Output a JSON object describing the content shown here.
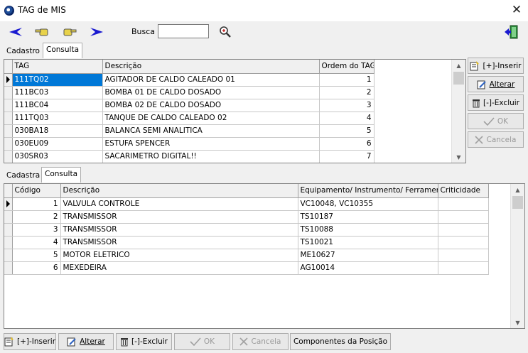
{
  "window": {
    "title": "TAG de MIS",
    "close_glyph": "✕"
  },
  "toolbar": {
    "icons": [
      "arrow-left-icon",
      "hand-left-icon",
      "hand-right-icon",
      "arrow-right-icon",
      "magnifier-icon",
      "exit-door-icon"
    ],
    "search_label": "Busca",
    "search_value": "",
    "colors": {
      "arrow_blue": "#1a1ad0",
      "hand_yellow": "#e8d24a",
      "exit_green": "#2a8a3a"
    }
  },
  "top_tabs": [
    "Cadastro",
    "Consulta"
  ],
  "top_grid": {
    "columns": [
      "TAG",
      "Descrição",
      "Ordem do TAG"
    ],
    "rows": [
      {
        "tag": "111TQ02",
        "descricao": "AGITADOR DE CALDO CALEADO 01",
        "ordem": "1"
      },
      {
        "tag": "111BC03",
        "descricao": "BOMBA 01 DE CALDO DOSADO",
        "ordem": "2"
      },
      {
        "tag": "111BC04",
        "descricao": "BOMBA 02 DE CALDO DOSADO",
        "ordem": "3"
      },
      {
        "tag": "111TQ03",
        "descricao": "TANQUE DE CALDO CALEADO 02",
        "ordem": "4"
      },
      {
        "tag": "030BA18",
        "descricao": "BALANCA SEMI ANALITICA",
        "ordem": "5"
      },
      {
        "tag": "030EU09",
        "descricao": "ESTUFA SPENCER",
        "ordem": "6"
      },
      {
        "tag": "030SR03",
        "descricao": "SACARIMETRO DIGITAL!!",
        "ordem": "7"
      }
    ]
  },
  "side_buttons": {
    "inserir": "[+]-Inserir",
    "alterar": "Alterar",
    "excluir": "[-]-Excluir",
    "ok": "OK",
    "cancela": "Cancela"
  },
  "bottom_tabs": [
    "Cadastra",
    "Consulta"
  ],
  "bottom_grid": {
    "columns": [
      "Código",
      "Descrição",
      "Equipamento/ Instrumento/ Ferramenta",
      "Criticidade"
    ],
    "rows": [
      {
        "codigo": "1",
        "descricao": "VALVULA CONTROLE",
        "equipamento": "VC10048, VC10355",
        "criticidade": ""
      },
      {
        "codigo": "2",
        "descricao": "TRANSMISSOR",
        "equipamento": "TS10187",
        "criticidade": ""
      },
      {
        "codigo": "3",
        "descricao": "TRANSMISSOR",
        "equipamento": "TS10088",
        "criticidade": ""
      },
      {
        "codigo": "4",
        "descricao": "TRANSMISSOR",
        "equipamento": "TS10021",
        "criticidade": ""
      },
      {
        "codigo": "5",
        "descricao": "MOTOR ELETRICO",
        "equipamento": "ME10627",
        "criticidade": ""
      },
      {
        "codigo": "6",
        "descricao": "MEXEDEIRA",
        "equipamento": "AG10014",
        "criticidade": ""
      }
    ]
  },
  "bottom_buttons": {
    "inserir": "[+]-Inserir",
    "alterar": "Alterar",
    "excluir": "[-]-Excluir",
    "ok": "OK",
    "cancela": "Cancela",
    "componentes": "Componentes da Posição"
  },
  "selection_color": "#0078d7"
}
